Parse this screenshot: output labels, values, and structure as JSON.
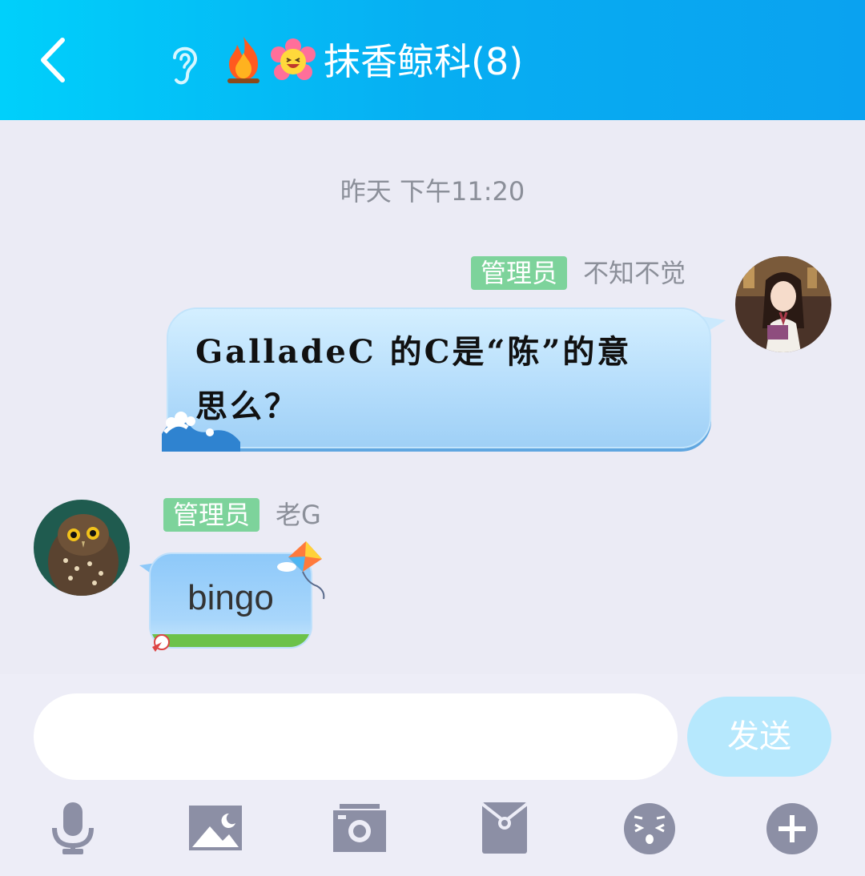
{
  "header": {
    "back_icon": "chevron-left-icon",
    "ear_icon": "ear-icon",
    "fire_icon": "fire-icon",
    "flower_icon": "laughing-flower-icon",
    "title": "抹香鲸科(8)",
    "background": "#07aef2"
  },
  "chat": {
    "timestamp": "昨天 下午11:20",
    "messages": [
      {
        "side": "right",
        "badge": "管理员",
        "sender": "不知不觉",
        "text_line1": "GalladeC 的C是“陈”的意",
        "text_line2": "思么？",
        "avatar": "anime-girl-avatar"
      },
      {
        "side": "left",
        "badge": "管理员",
        "sender": "老G",
        "text": "bingo",
        "avatar": "owl-avatar"
      }
    ]
  },
  "input_bar": {
    "placeholder": "",
    "value": "",
    "send_label": "发送"
  },
  "toolbar": {
    "items": [
      "microphone-icon",
      "image-icon",
      "camera-icon",
      "red-packet-icon",
      "emoji-icon",
      "plus-icon"
    ]
  },
  "colors": {
    "badge": "#7dd39b",
    "send_button": "#b6e8fd",
    "toolbar_icon": "#8c8fa5"
  }
}
